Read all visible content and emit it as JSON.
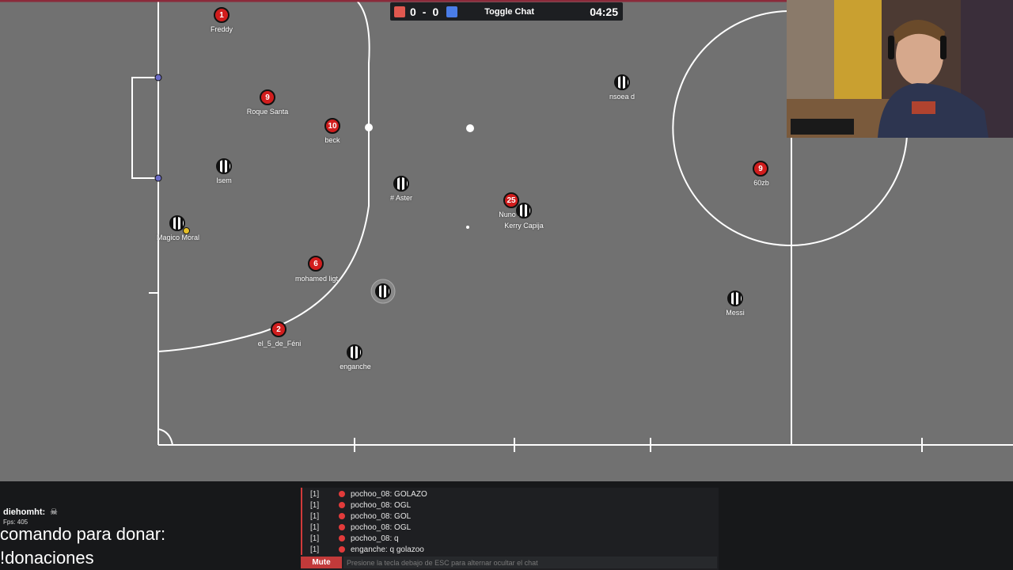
{
  "scoreboard": {
    "red_score": "0",
    "separator": "-",
    "blue_score": "0",
    "toggle_chat_label": "Toggle Chat",
    "timer": "04:25",
    "red_color": "#e0584f",
    "blue_color": "#4a7de8"
  },
  "players": [
    {
      "team": "red",
      "number": "1",
      "name": "Freddy"
    },
    {
      "team": "red",
      "number": "9",
      "name": "Roque Santa"
    },
    {
      "team": "red",
      "number": "10",
      "name": "beck"
    },
    {
      "team": "blue",
      "number": "",
      "name": "Isem"
    },
    {
      "team": "blue",
      "number": "",
      "name": "Magico Moral"
    },
    {
      "team": "red",
      "number": "6",
      "name": "mohamed ligt"
    },
    {
      "team": "red",
      "number": "2",
      "name": "el_5_de_Féni"
    },
    {
      "team": "blue",
      "number": "",
      "name": "enganche"
    },
    {
      "team": "blue",
      "number": "",
      "name": "# Aster"
    },
    {
      "team": "red",
      "number": "25",
      "name": "Nuno M"
    },
    {
      "team": "blue",
      "number": "",
      "name": "Kerry Capija"
    },
    {
      "team": "blue",
      "number": "",
      "name": "nsoea d"
    },
    {
      "team": "red",
      "number": "9",
      "name": "60zb"
    },
    {
      "team": "blue",
      "number": "",
      "name": "Messi"
    },
    {
      "team": "blue",
      "number": "",
      "name": ""
    }
  ],
  "overlay": {
    "streamer_name": "diehomht:",
    "fps": "Fps: 405",
    "donate_line1": "comando para donar:",
    "donate_line2": "!donaciones"
  },
  "chat": {
    "messages": [
      {
        "tag": "[1]",
        "text": "pochoo_08: GOLAZO"
      },
      {
        "tag": "[1]",
        "text": "pochoo_08: OGL"
      },
      {
        "tag": "[1]",
        "text": "pochoo_08: GOL"
      },
      {
        "tag": "[1]",
        "text": "pochoo_08: OGL"
      },
      {
        "tag": "[1]",
        "text": "pochoo_08: q"
      },
      {
        "tag": "[1]",
        "text": "enganche: q golazoo"
      }
    ],
    "mute_label": "Mute",
    "input_placeholder": "Presione la tecla debajo de ESC para alternar ocultar el chat"
  },
  "icons": {
    "streamer_badge": "skull-icon",
    "webcam": "webcam-feed"
  }
}
